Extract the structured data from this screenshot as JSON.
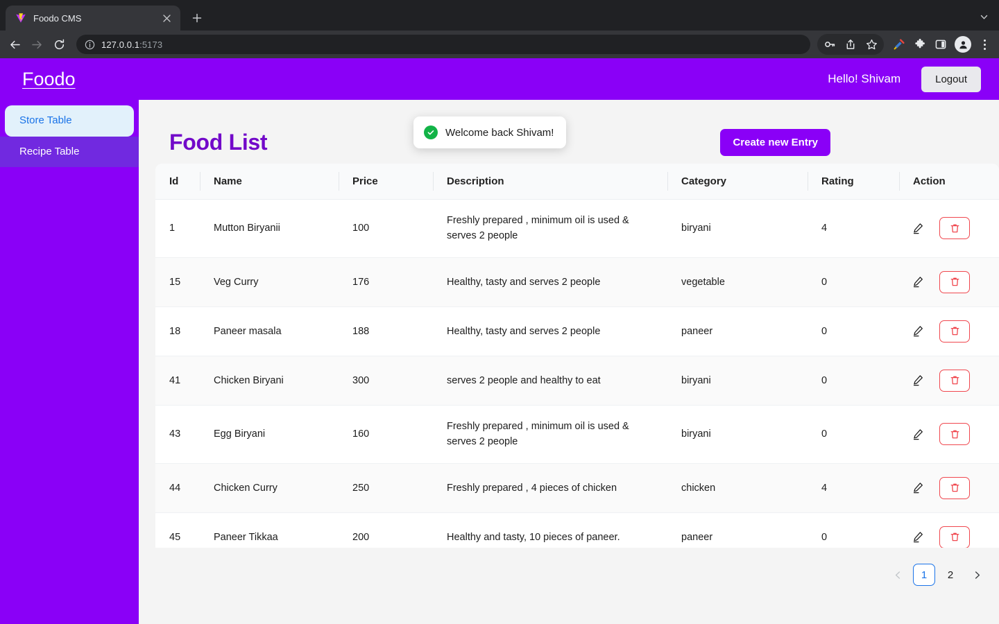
{
  "browser": {
    "tab": {
      "title": "Foodo CMS",
      "favicon_icon": "vite-logo-icon",
      "close_icon": "close-icon"
    },
    "new_tab_icon": "plus-icon",
    "tab_list_icon": "chevron-down-icon",
    "back_icon": "back-arrow-icon",
    "forward_icon": "forward-arrow-icon",
    "reload_icon": "reload-icon",
    "site_info_icon": "info-icon",
    "url": "127.0.0.1",
    "url_port": ":5173",
    "toolbar_icons": [
      "password-key-icon",
      "share-icon",
      "bookmark-star-icon",
      "eyedropper-icon",
      "extensions-puzzle-icon",
      "side-panel-icon",
      "profile-avatar-icon",
      "three-dot-menu-icon"
    ]
  },
  "header": {
    "brand": "Foodo",
    "greeting": "Hello! Shivam",
    "logout_label": "Logout"
  },
  "sidebar": {
    "items": [
      {
        "label": "Store Table",
        "active": true
      },
      {
        "label": "Recipe Table",
        "active": false
      }
    ]
  },
  "main": {
    "page_title": "Food List",
    "create_button_label": "Create new Entry"
  },
  "toast": {
    "message": "Welcome back Shivam!",
    "icon": "check-circle-icon",
    "color": "#12b347"
  },
  "table": {
    "columns": [
      "Id",
      "Name",
      "Price",
      "Description",
      "Category",
      "Rating",
      "Action"
    ],
    "edit_icon": "pencil-edit-icon",
    "delete_icon": "trash-delete-icon",
    "rows": [
      {
        "id": "1",
        "name": "Mutton Biryanii",
        "price": "100",
        "description": "Freshly prepared , minimum oil is used & serves 2 people",
        "category": "biryani",
        "rating": "4"
      },
      {
        "id": "15",
        "name": "Veg Curry",
        "price": "176",
        "description": "Healthy, tasty and serves 2 people",
        "category": "vegetable",
        "rating": "0"
      },
      {
        "id": "18",
        "name": "Paneer masala",
        "price": "188",
        "description": "Healthy, tasty and serves 2 people",
        "category": "paneer",
        "rating": "0"
      },
      {
        "id": "41",
        "name": "Chicken Biryani",
        "price": "300",
        "description": "serves 2 people and healthy to eat",
        "category": "biryani",
        "rating": "0"
      },
      {
        "id": "43",
        "name": "Egg Biryani",
        "price": "160",
        "description": "Freshly prepared , minimum oil is used & serves 2 people",
        "category": "biryani",
        "rating": "0"
      },
      {
        "id": "44",
        "name": "Chicken Curry",
        "price": "250",
        "description": "Freshly prepared , 4 pieces of chicken",
        "category": "chicken",
        "rating": "4"
      },
      {
        "id": "45",
        "name": "Paneer Tikkaa",
        "price": "200",
        "description": "Healthy and tasty, 10 pieces of paneer.",
        "category": "paneer",
        "rating": "0"
      }
    ]
  },
  "pagination": {
    "prev_icon": "chevron-left-icon",
    "next_icon": "chevron-right-icon",
    "pages": [
      "1",
      "2"
    ],
    "current_page": "1"
  },
  "colors": {
    "brand_purple": "#8A00F7",
    "title_purple": "#7209C9",
    "nav_active_bg": "#e2f1fb",
    "nav_active_text": "#1a73e8",
    "delete_red": "#f0474e",
    "page_bg": "#f4f4f4"
  }
}
